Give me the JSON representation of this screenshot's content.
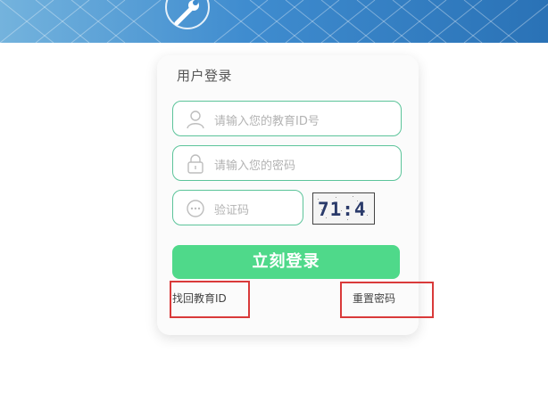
{
  "login": {
    "title": "用户登录",
    "id_placeholder": "请输入您的教育ID号",
    "password_placeholder": "请输入您的密码",
    "captcha_placeholder": "验证码",
    "captcha_text": "71:4",
    "submit_label": "立刻登录",
    "find_id_link": "找回教育ID",
    "reset_password_link": "重置密码"
  },
  "icons": {
    "banner": "wrench-icon",
    "id_field": "user-icon",
    "password_field": "lock-icon",
    "captcha_field": "chat-bubble-icon"
  },
  "colors": {
    "accent": "#4fd98a",
    "field_border": "#5cc49a",
    "banner": "#3f8ccf",
    "highlight": "#d93a3a"
  }
}
